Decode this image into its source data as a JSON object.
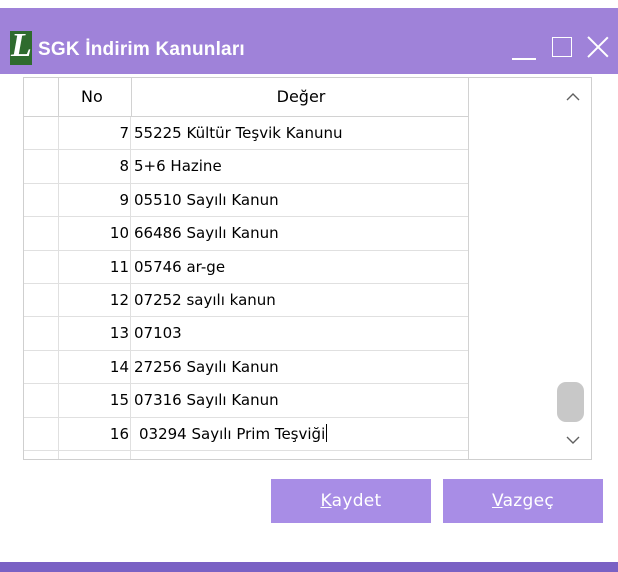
{
  "window": {
    "title": "SGK İndirim Kanunları",
    "logo_letter": "L",
    "title_bar_color": "#9f82d9",
    "logo_color": "#2f6b2e"
  },
  "grid": {
    "columns": [
      "No",
      "Değer"
    ],
    "rows": [
      {
        "no": "7",
        "value": "55225 Kültür Teşvik Kanunu"
      },
      {
        "no": "8",
        "value": "5+6 Hazine"
      },
      {
        "no": "9",
        "value": "05510 Sayılı Kanun"
      },
      {
        "no": "10",
        "value": "66486  Sayılı Kanun"
      },
      {
        "no": "11",
        "value": "05746 ar-ge"
      },
      {
        "no": "12",
        "value": "07252 sayılı kanun"
      },
      {
        "no": "13",
        "value": "07103"
      },
      {
        "no": "14",
        "value": "27256 Sayılı Kanun"
      },
      {
        "no": "15",
        "value": "07316 Sayılı Kanun"
      },
      {
        "no": "16",
        "value": "03294 Sayılı Prim Teşviği"
      }
    ]
  },
  "buttons": {
    "save_mnemonic": "K",
    "save_rest": "aydet",
    "cancel_mnemonic": "V",
    "cancel_rest": "azgeç",
    "color": "#a88de6"
  }
}
